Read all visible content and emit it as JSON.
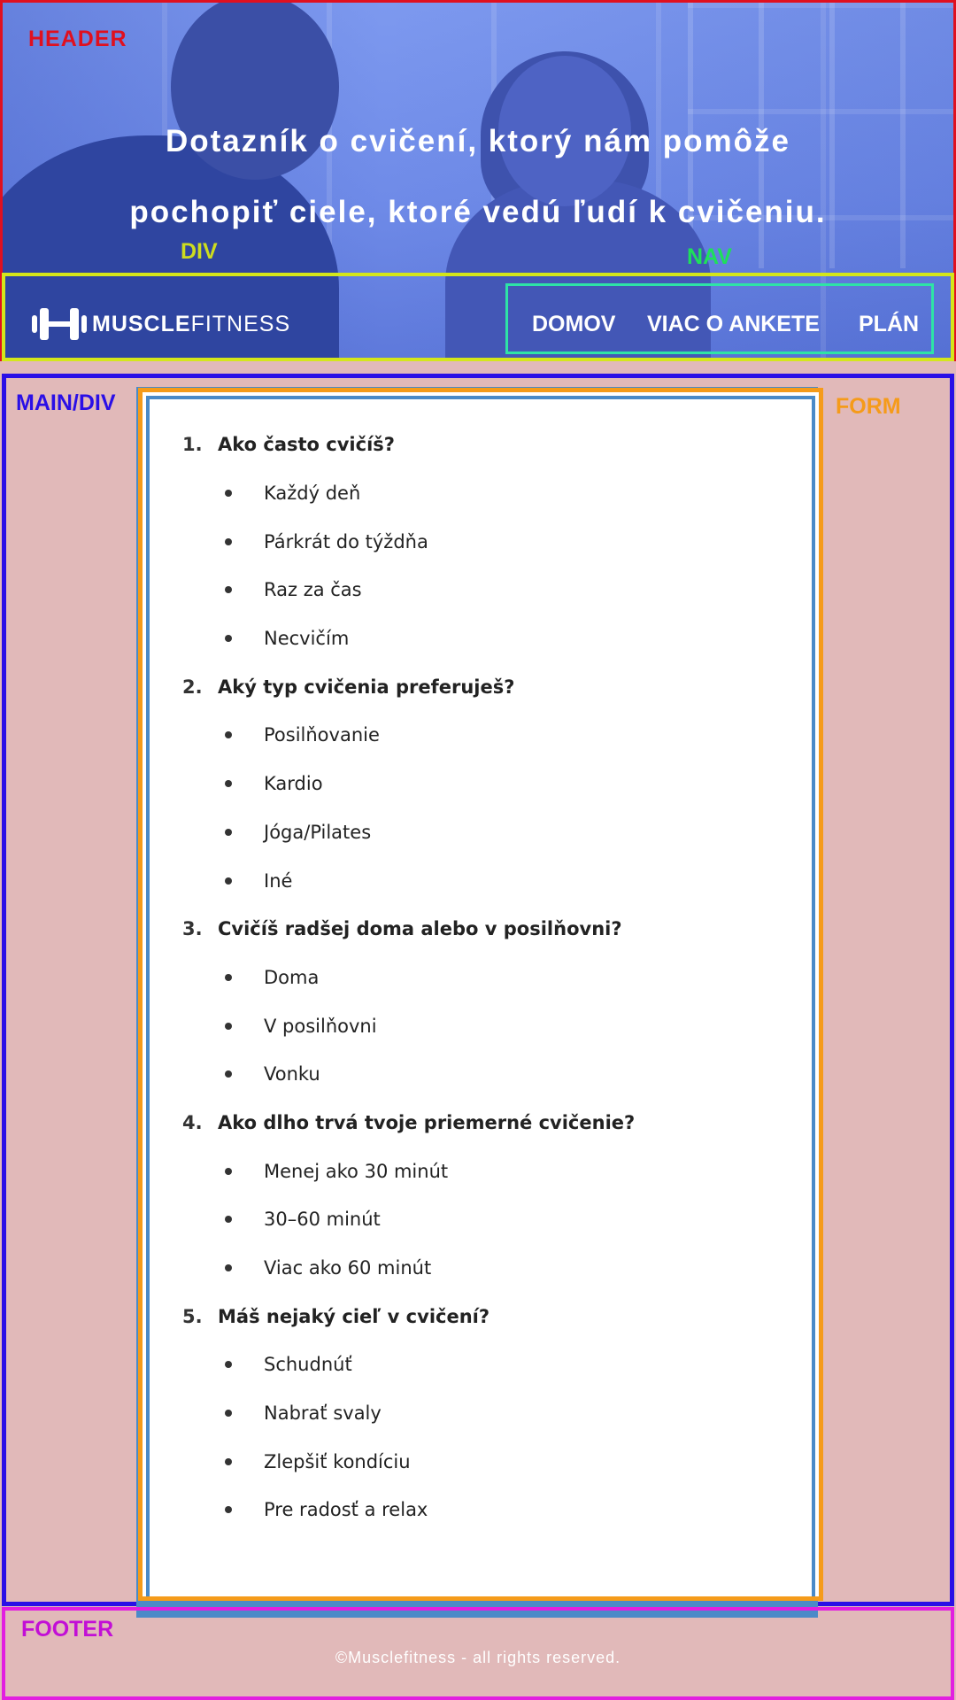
{
  "annotations": {
    "header": "HEADER",
    "div": "DIV",
    "nav": "NAV",
    "main": "MAIN/DIV",
    "form": "FORM",
    "footer": "FOOTER"
  },
  "header": {
    "title_line1": "Dotazník o cvičení, ktorý nám pomôže",
    "title_line2": "pochopiť ciele, ktoré vedú ľudí k cvičeniu."
  },
  "logo": {
    "bold": "MUSCLE",
    "light": "FITNESS",
    "icon": "dumbbell-icon"
  },
  "nav": {
    "items": [
      {
        "label": "DOMOV"
      },
      {
        "label": "VIAC O ANKETE"
      },
      {
        "label": "PLÁN"
      }
    ]
  },
  "questions": [
    {
      "num": "1.",
      "text": "Ako často cvičíš?",
      "options": [
        "Každý deň",
        "Párkrát do týždňa",
        "Raz za čas",
        "Necvičím"
      ]
    },
    {
      "num": "2.",
      "text": "Aký typ cvičenia preferuješ?",
      "options": [
        "Posilňovanie",
        "Kardio",
        "Jóga/Pilates",
        "Iné"
      ]
    },
    {
      "num": "3.",
      "text": "Cvičíš radšej doma alebo v posilňovni?",
      "options": [
        "Doma",
        "V posilňovni",
        "Vonku"
      ]
    },
    {
      "num": "4.",
      "text": "Ako dlho trvá tvoje priemerné cvičenie?",
      "options": [
        "Menej ako 30 minút",
        "30–60 minút",
        "Viac ako 60 minút"
      ]
    },
    {
      "num": "5.",
      "text": "Máš nejaký cieľ v cvičení?",
      "options": [
        "Schudnúť",
        "Nabrať svaly",
        "Zlepšiť kondíciu",
        "Pre radosť a relax"
      ]
    }
  ],
  "footer": {
    "text": "©Musclefitness - all rights reserved."
  },
  "colors": {
    "header_border": "#e0101f",
    "div_border": "#d4e61a",
    "nav_border": "#2ee3a6",
    "main_border": "#2a0fe6",
    "form_border": "#f59b1a",
    "footer_border": "#e21fe0",
    "page_bg": "#e1b9b9"
  }
}
